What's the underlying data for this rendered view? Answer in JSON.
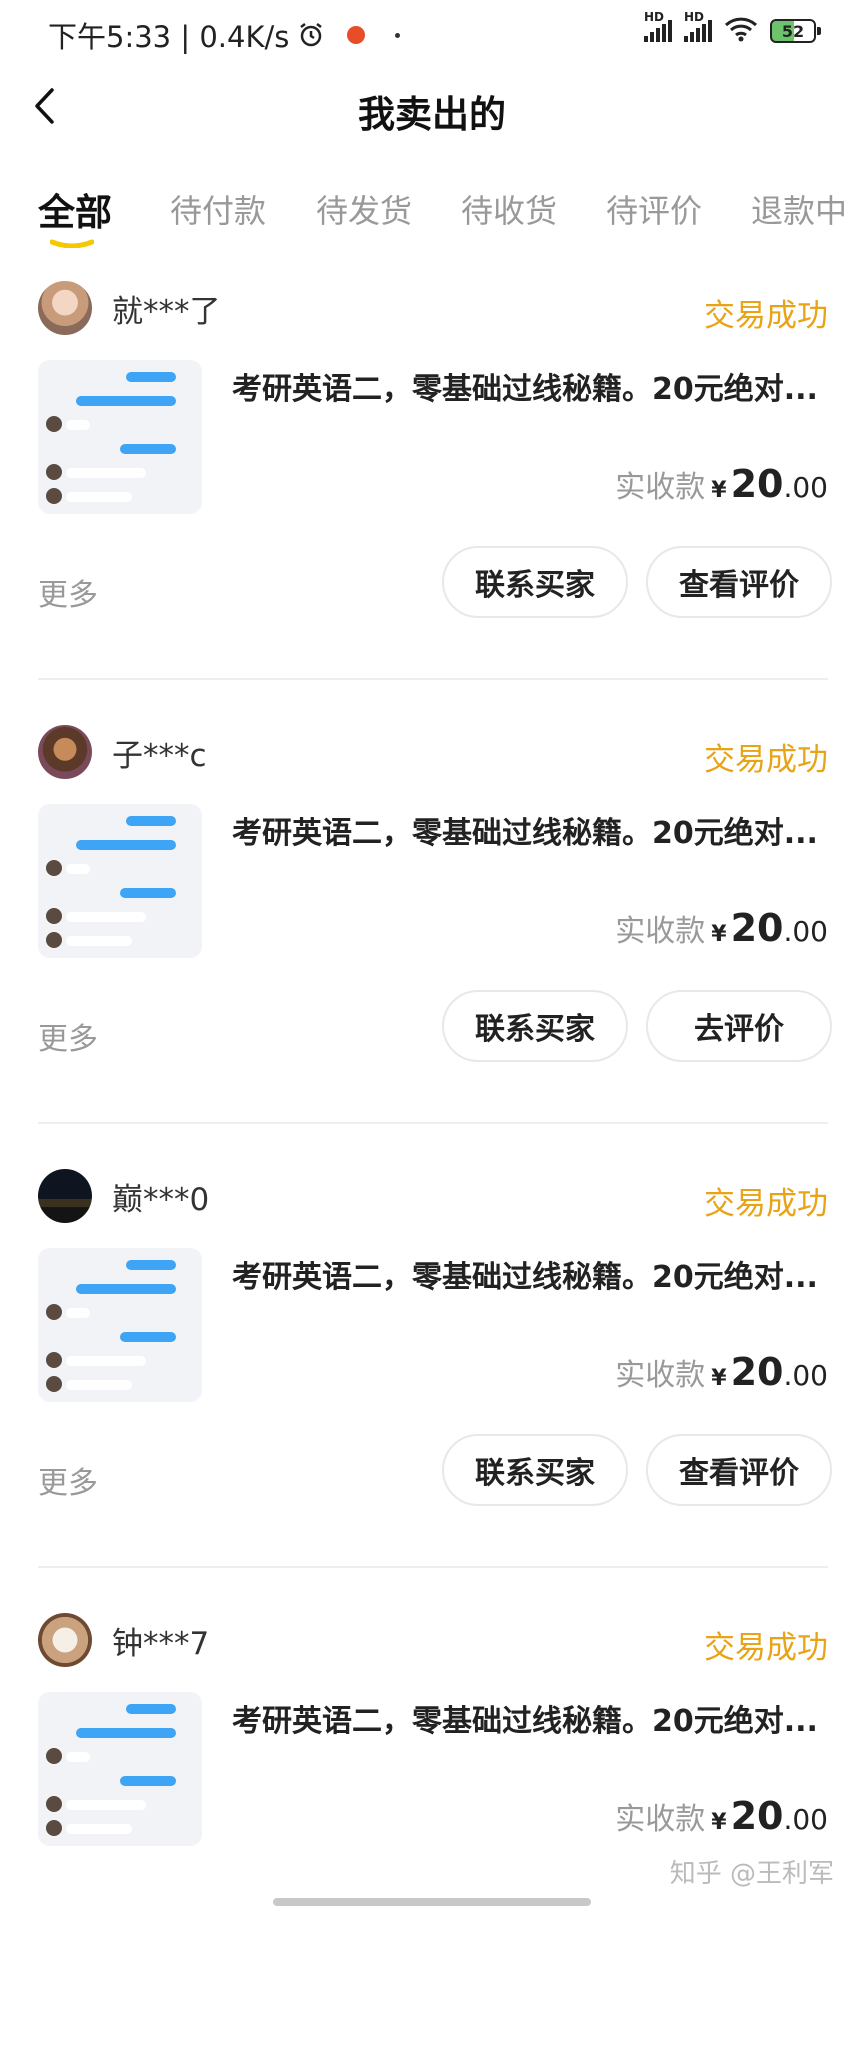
{
  "status_bar": {
    "time_speed": "下午5:33 | 0.4K/s",
    "hd_1": "HD",
    "hd_2": "HD",
    "battery": "52"
  },
  "nav": {
    "title": "我卖出的"
  },
  "tabs": [
    {
      "label": "全部",
      "active": true
    },
    {
      "label": "待付款"
    },
    {
      "label": "待发货"
    },
    {
      "label": "待收货"
    },
    {
      "label": "待评价"
    },
    {
      "label": "退款中"
    }
  ],
  "colors": {
    "accent_yellow": "#f5c800",
    "status_orange": "#e8a317",
    "chat_blue": "#3ea4f5"
  },
  "orders": [
    {
      "buyer": "就***了",
      "status": "交易成功",
      "title": "考研英语二，零基础过线秘籍。20元绝对...",
      "price_label": "实收款",
      "currency": "¥",
      "price_int": "20",
      "price_dec": ".00",
      "more": "更多",
      "contact": "联系买家",
      "action": "查看评价"
    },
    {
      "buyer": "子***c",
      "status": "交易成功",
      "title": "考研英语二，零基础过线秘籍。20元绝对...",
      "price_label": "实收款",
      "currency": "¥",
      "price_int": "20",
      "price_dec": ".00",
      "more": "更多",
      "contact": "联系买家",
      "action": "去评价"
    },
    {
      "buyer": "巅***0",
      "status": "交易成功",
      "title": "考研英语二，零基础过线秘籍。20元绝对...",
      "price_label": "实收款",
      "currency": "¥",
      "price_int": "20",
      "price_dec": ".00",
      "more": "更多",
      "contact": "联系买家",
      "action": "查看评价"
    },
    {
      "buyer": "钟***7",
      "status": "交易成功",
      "title": "考研英语二，零基础过线秘籍。20元绝对...",
      "price_label": "实收款",
      "currency": "¥",
      "price_int": "20",
      "price_dec": ".00"
    }
  ],
  "watermark": "知乎 @王利军"
}
